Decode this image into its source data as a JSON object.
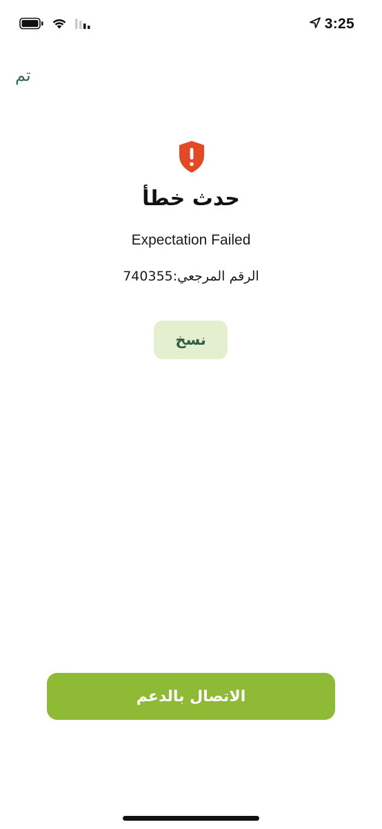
{
  "status_bar": {
    "time": "3:25",
    "battery_icon": "battery-icon",
    "wifi_icon": "wifi-icon",
    "signal_icon": "cellular-signal-icon",
    "location_icon": "location-arrow-icon"
  },
  "nav": {
    "done_label": "تم"
  },
  "error": {
    "icon": "shield-alert-icon",
    "icon_color": "#e14a24",
    "title": "حدث خطأ",
    "message": "Expectation Failed",
    "reference_text": "الرقم المرجعي:740355"
  },
  "actions": {
    "copy_label": "نسخ",
    "support_label": "الاتصال بالدعم"
  },
  "colors": {
    "accent_green": "#8fba36",
    "copy_bg": "#e4efcf",
    "link_green": "#2f6b52"
  }
}
